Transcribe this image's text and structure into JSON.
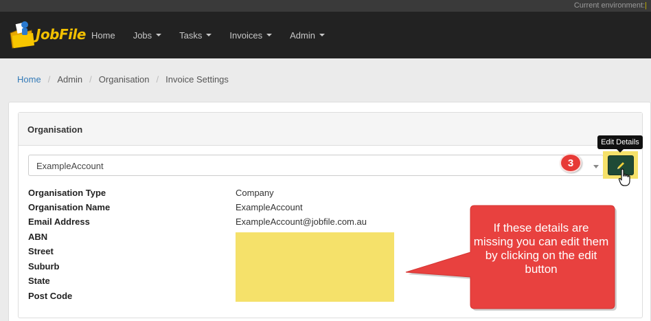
{
  "env": {
    "label": "Current environment:"
  },
  "brand": {
    "name": "JobFile"
  },
  "nav": {
    "items": [
      {
        "label": "Home",
        "has_dropdown": false
      },
      {
        "label": "Jobs",
        "has_dropdown": true
      },
      {
        "label": "Tasks",
        "has_dropdown": true
      },
      {
        "label": "Invoices",
        "has_dropdown": true
      },
      {
        "label": "Admin",
        "has_dropdown": true
      }
    ]
  },
  "breadcrumb": [
    {
      "label": "Home",
      "link": true
    },
    {
      "label": "Admin",
      "link": false
    },
    {
      "label": "Organisation",
      "link": false
    },
    {
      "label": "Invoice Settings",
      "link": false
    }
  ],
  "panel": {
    "title": "Organisation",
    "select": {
      "value": "ExampleAccount"
    },
    "edit_tooltip": "Edit Details",
    "step_badge": "3",
    "fields": [
      {
        "label": "Organisation Type",
        "value": "Company"
      },
      {
        "label": "Organisation Name",
        "value": "ExampleAccount"
      },
      {
        "label": "Email Address",
        "value": "ExampleAccount@jobfile.com.au"
      },
      {
        "label": "ABN",
        "value": ""
      },
      {
        "label": "Street",
        "value": ""
      },
      {
        "label": "Suburb",
        "value": ""
      },
      {
        "label": "State",
        "value": ""
      },
      {
        "label": "Post Code",
        "value": ""
      }
    ]
  },
  "callout": {
    "text": "If these details are missing you can edit them by clicking on the edit button"
  },
  "colors": {
    "navbar": "#222222",
    "brand": "#f2c000",
    "link": "#337ab7",
    "edit_button": "#1f4a36",
    "highlight": "#f5e16a",
    "callout": "#e8413f"
  },
  "icons": {
    "logo": "folder-logo-icon",
    "edit": "pencil-icon",
    "cursor": "hand-pointer-icon",
    "select_caret": "caret-down-icon"
  }
}
